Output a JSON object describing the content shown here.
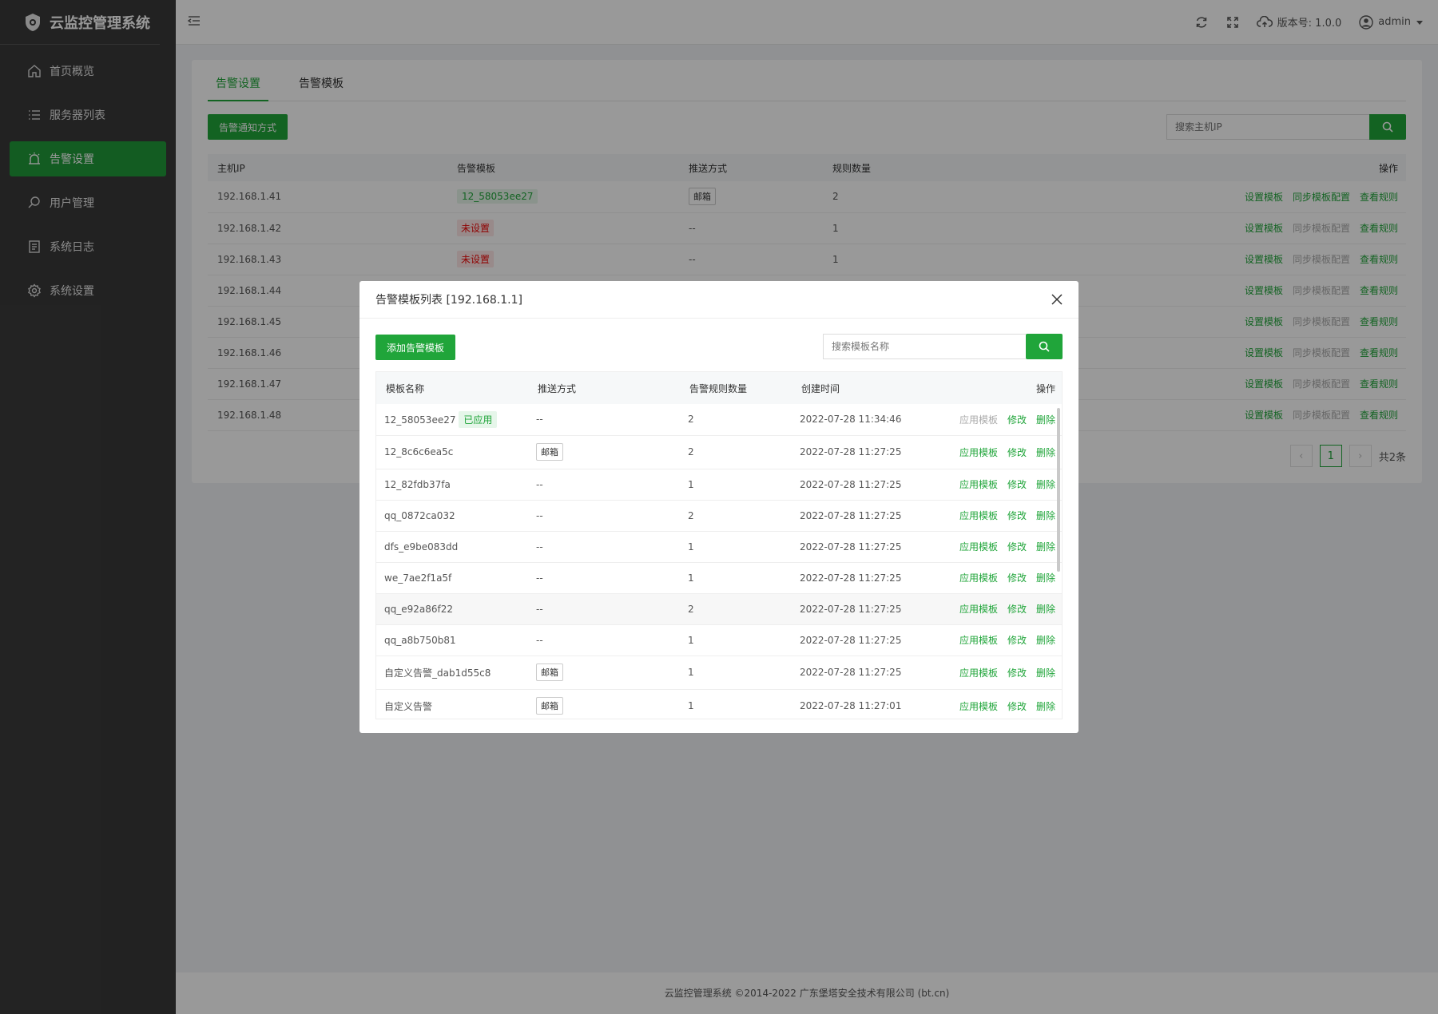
{
  "app": {
    "title": "云监控管理系统",
    "version_label": "版本号: 1.0.0",
    "user": "admin"
  },
  "sidebar": {
    "items": [
      {
        "label": "首页概览",
        "icon": "home-icon"
      },
      {
        "label": "服务器列表",
        "icon": "list-icon"
      },
      {
        "label": "告警设置",
        "icon": "alarm-icon",
        "active": true
      },
      {
        "label": "用户管理",
        "icon": "search-user-icon"
      },
      {
        "label": "系统日志",
        "icon": "log-icon"
      },
      {
        "label": "系统设置",
        "icon": "gear-icon"
      }
    ]
  },
  "main": {
    "tabs": [
      "告警设置",
      "告警模板"
    ],
    "notify_button": "告警通知方式",
    "search_placeholder": "搜索主机IP",
    "columns": [
      "主机IP",
      "告警模板",
      "推送方式",
      "规则数量",
      "操作"
    ],
    "ops": [
      "设置模板",
      "同步模板配置",
      "查看规则"
    ],
    "rows": [
      {
        "ip": "192.168.1.41",
        "template": "12_58053ee27",
        "push": "邮箱",
        "count": "2"
      },
      {
        "ip": "192.168.1.42",
        "template": "未设置",
        "push": "--",
        "count": "1"
      },
      {
        "ip": "192.168.1.43",
        "template": "未设置",
        "push": "--",
        "count": "1"
      },
      {
        "ip": "192.168.1.44"
      },
      {
        "ip": "192.168.1.45"
      },
      {
        "ip": "192.168.1.46"
      },
      {
        "ip": "192.168.1.47"
      },
      {
        "ip": "192.168.1.48"
      }
    ],
    "pager": {
      "current": "1",
      "total": "共2条"
    }
  },
  "modal": {
    "title": "告警模板列表 [192.168.1.1]",
    "add_button": "添加告警模板",
    "search_placeholder": "搜索模板名称",
    "columns": [
      "模板名称",
      "推送方式",
      "告警规则数量",
      "创建时间",
      "操作"
    ],
    "applied_tag": "已应用",
    "ops": [
      "应用模板",
      "修改",
      "删除"
    ],
    "rows": [
      {
        "name": "12_58053ee27",
        "push": "--",
        "count": "2",
        "time": "2022-07-28 11:34:46",
        "applied": true
      },
      {
        "name": "12_8c6c6ea5c",
        "push": "邮箱",
        "count": "2",
        "time": "2022-07-28 11:27:25"
      },
      {
        "name": "12_82fdb37fa",
        "push": "--",
        "count": "1",
        "time": "2022-07-28 11:27:25"
      },
      {
        "name": "qq_0872ca032",
        "push": "--",
        "count": "2",
        "time": "2022-07-28 11:27:25"
      },
      {
        "name": "dfs_e9be083dd",
        "push": "--",
        "count": "1",
        "time": "2022-07-28 11:27:25"
      },
      {
        "name": "we_7ae2f1a5f",
        "push": "--",
        "count": "1",
        "time": "2022-07-28 11:27:25"
      },
      {
        "name": "qq_e92a86f22",
        "push": "--",
        "count": "2",
        "time": "2022-07-28 11:27:25"
      },
      {
        "name": "qq_a8b750b81",
        "push": "--",
        "count": "1",
        "time": "2022-07-28 11:27:25"
      },
      {
        "name": "自定义告警_dab1d55c8",
        "push": "邮箱",
        "count": "1",
        "time": "2022-07-28 11:27:25"
      },
      {
        "name": "自定义告警",
        "push": "邮箱",
        "count": "1",
        "time": "2022-07-28 11:27:01"
      }
    ]
  },
  "footer": {
    "text": "云监控管理系统 ©2014-2022 广东堡塔安全技术有限公司 (bt.cn)"
  },
  "colors": {
    "accent": "#20a53a",
    "sidebar": "#3a3a3a",
    "danger": "#ef0808"
  }
}
